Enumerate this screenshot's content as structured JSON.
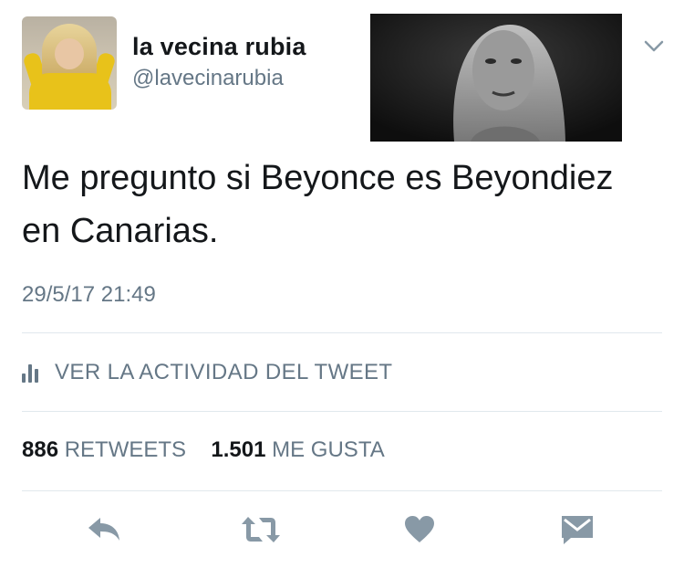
{
  "user": {
    "display_name": "la vecina rubia",
    "handle": "@lavecinarubia"
  },
  "tweet": {
    "text": "Me pregunto si Beyonce es Beyondiez en Canarias.",
    "timestamp": "29/5/17 21:49"
  },
  "activity": {
    "label": "VER LA ACTIVIDAD DEL TWEET"
  },
  "stats": {
    "retweets_count": "886",
    "retweets_label": "RETWEETS",
    "likes_count": "1.501",
    "likes_label": "ME GUSTA"
  },
  "icons": {
    "reply": "reply-icon",
    "retweet": "retweet-icon",
    "like": "heart-icon",
    "message": "direct-message-icon",
    "menu": "chevron-down-icon",
    "activity": "bar-chart-icon"
  },
  "colors": {
    "primary_text": "#14171a",
    "secondary_text": "#657786",
    "icon_gray": "#8899a6",
    "divider": "#e1e8ed"
  }
}
